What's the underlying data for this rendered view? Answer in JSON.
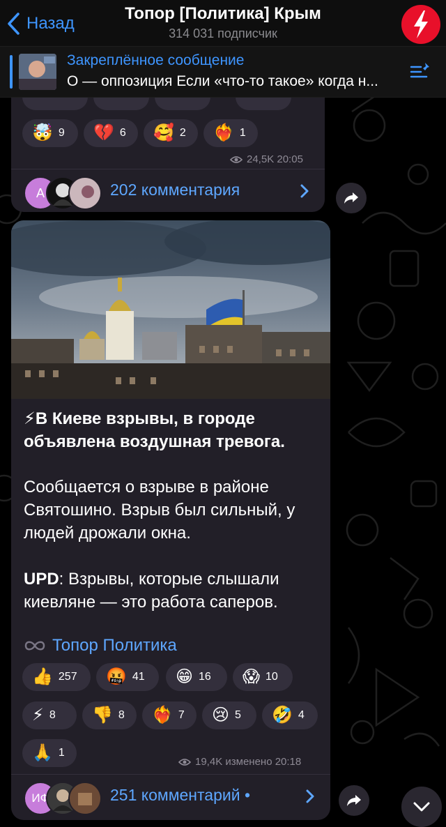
{
  "header": {
    "back_label": "Назад",
    "title": "Топор [Политика] Крым",
    "subtitle": "314 031 подписчик"
  },
  "pinned": {
    "heading": "Закреплённое сообщение",
    "text": "О — оппозиция Если «что-то такое» когда н..."
  },
  "post1": {
    "reactions": [
      {
        "emoji": "🤯",
        "count": "9",
        "icon": "exploding-head-emoji"
      },
      {
        "emoji": "💔",
        "count": "6",
        "icon": "broken-heart-emoji"
      },
      {
        "emoji": "🥰",
        "count": "2",
        "icon": "smiling-hearts-emoji"
      },
      {
        "emoji": "❤️‍🔥",
        "count": "1",
        "icon": "heart-on-fire-emoji"
      }
    ],
    "views": "24,5K",
    "time": "20:05",
    "comments_label": "202 комментария",
    "comment_avatar_letter": "A"
  },
  "post2": {
    "headline_emoji": "⚡",
    "headline": "В Киеве взрывы, в городе объявлена воздушная тревога.",
    "para1": "Сообщается о взрыве в районе Святошино. Взрыв был сильный, у людей дрожали окна.",
    "upd_label": "UPD",
    "upd_text": ": Взрывы, которые слышали киевляне — это работа саперов.",
    "link_label": "Топор Политика",
    "reactions": [
      {
        "emoji": "👍",
        "count": "257",
        "icon": "thumbs-up-emoji"
      },
      {
        "emoji": "🤬",
        "count": "41",
        "icon": "cursing-face-emoji"
      },
      {
        "emoji": "😁",
        "count": "16",
        "icon": "grinning-face-emoji"
      },
      {
        "emoji": "😱",
        "count": "10",
        "icon": "screaming-face-emoji"
      },
      {
        "emoji": "⚡",
        "count": "8",
        "icon": "lightning-emoji"
      },
      {
        "emoji": "👎",
        "count": "8",
        "icon": "thumbs-down-emoji"
      },
      {
        "emoji": "❤️‍🔥",
        "count": "7",
        "icon": "heart-on-fire-emoji"
      },
      {
        "emoji": "😢",
        "count": "5",
        "icon": "crying-face-emoji"
      },
      {
        "emoji": "🤣",
        "count": "4",
        "icon": "rolling-laughing-emoji"
      },
      {
        "emoji": "🙏",
        "count": "1",
        "icon": "folded-hands-emoji"
      }
    ],
    "views": "19,4K",
    "edited_time": "изменено 20:18",
    "comments_label": "251 комментарий •",
    "comment_avatar_letters": "ИФ"
  },
  "colors": {
    "accent": "#3e95ff",
    "bubble": "#221f28",
    "reaction_bg": "#332f3c",
    "logo_red": "#e8102a"
  }
}
